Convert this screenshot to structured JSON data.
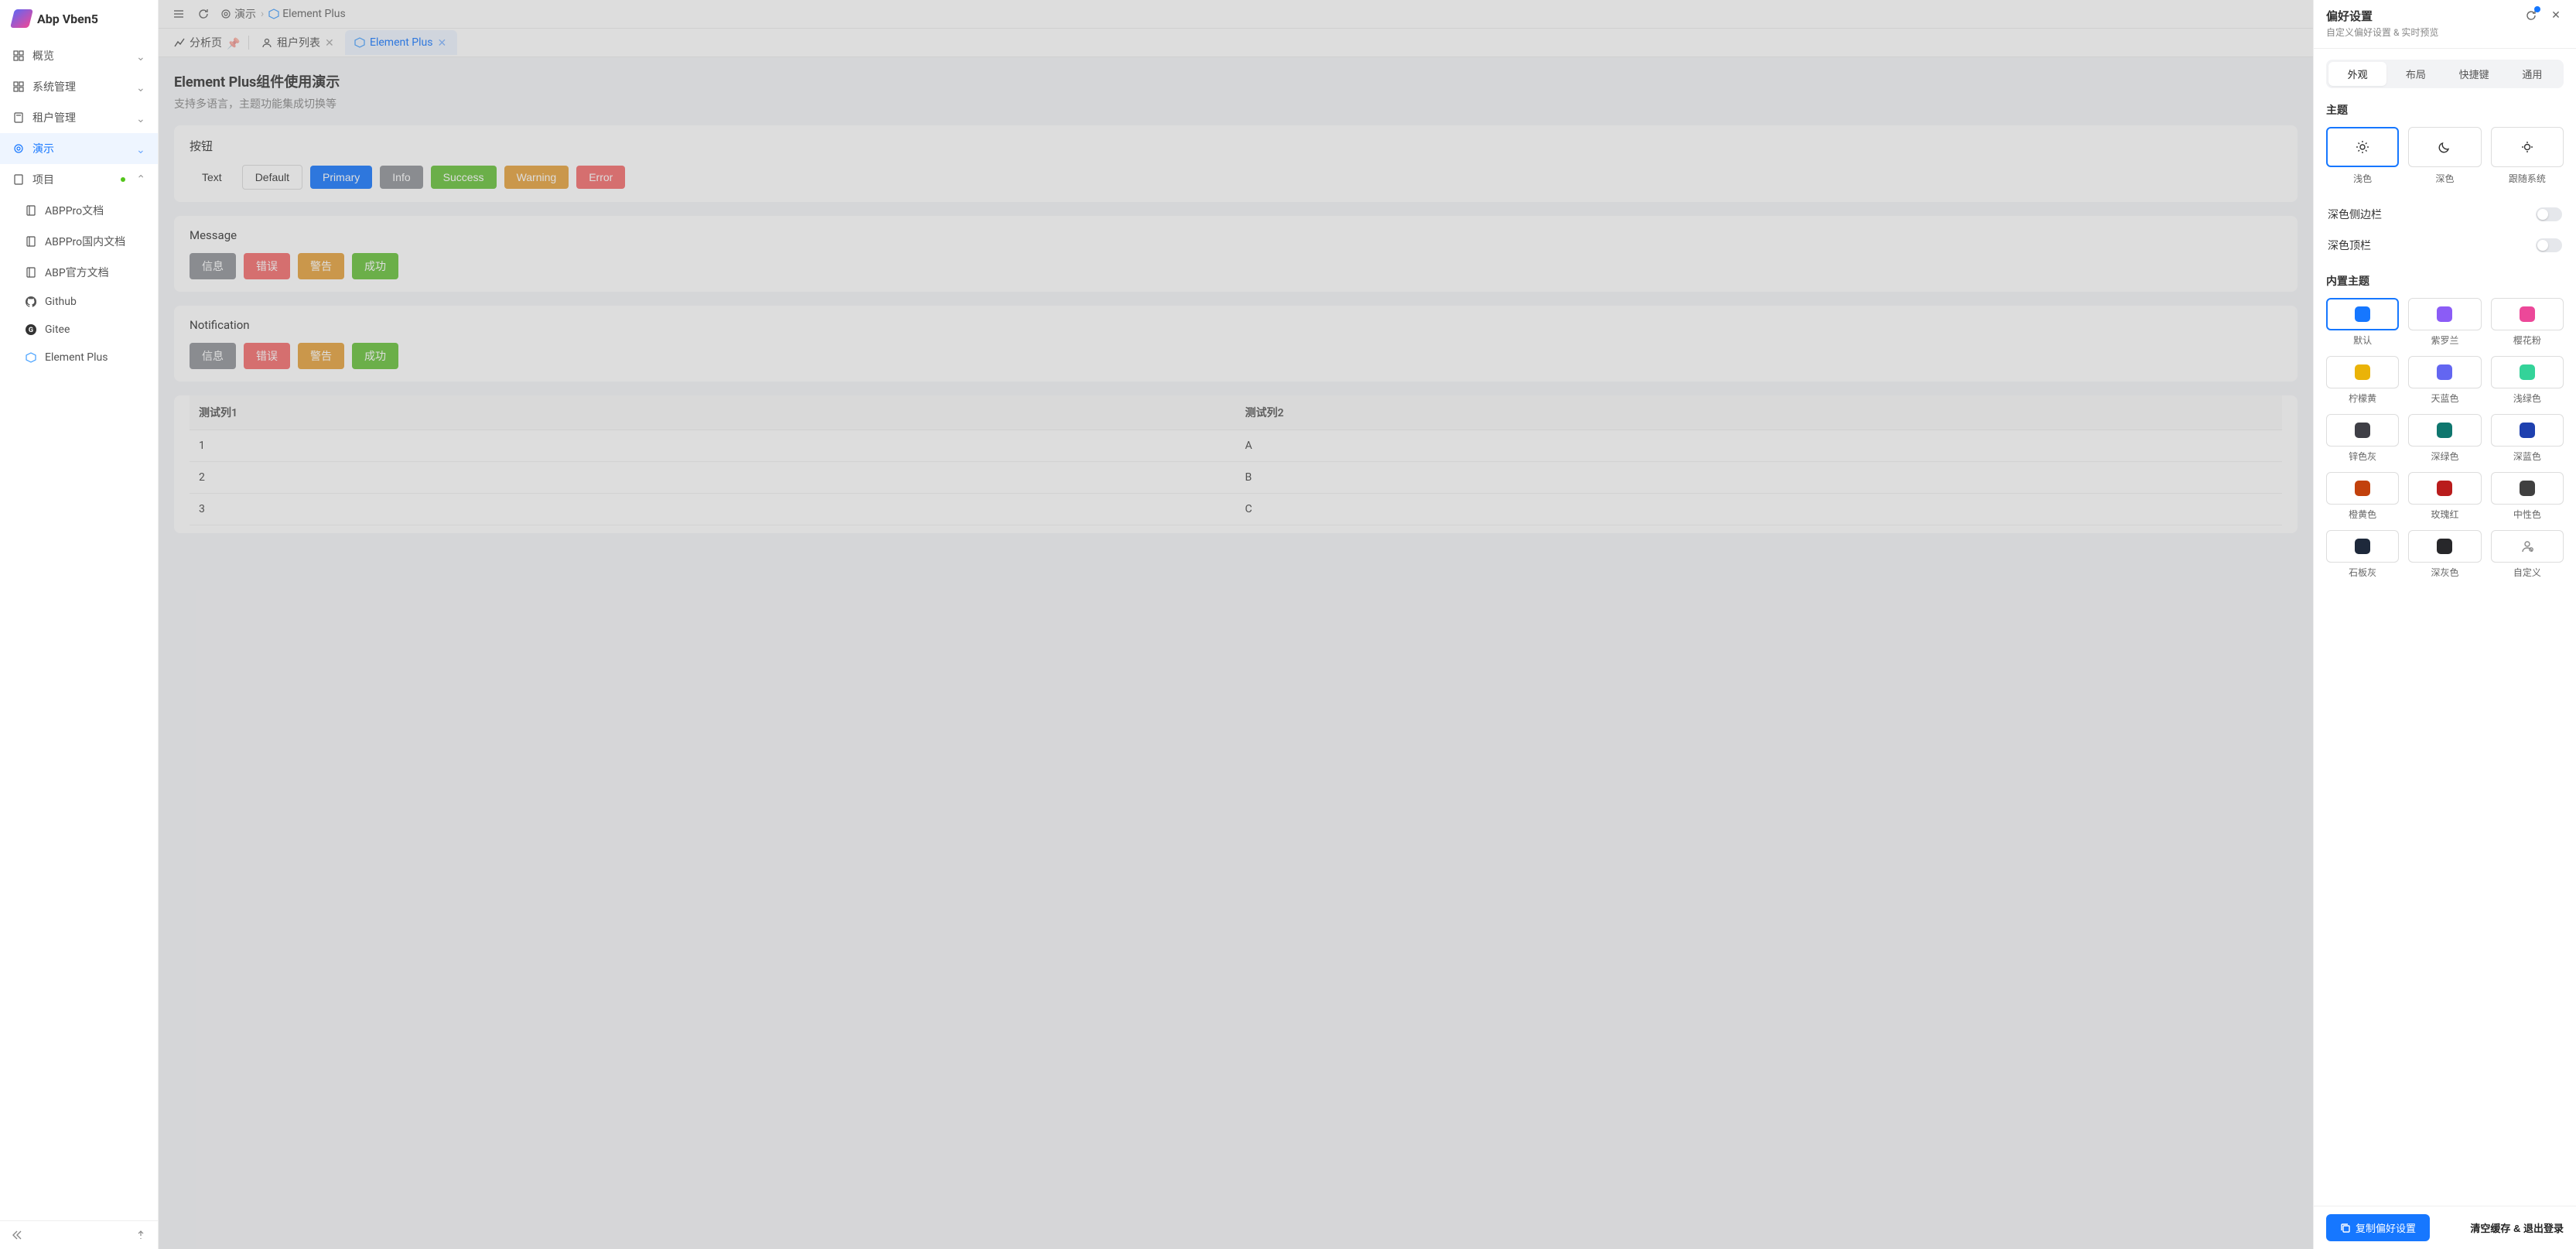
{
  "app": {
    "name": "Abp Vben5"
  },
  "sidebar": {
    "items": [
      {
        "label": "概览",
        "icon": "grid"
      },
      {
        "label": "系统管理",
        "icon": "grid"
      },
      {
        "label": "租户管理",
        "icon": "book"
      },
      {
        "label": "演示",
        "icon": "target",
        "active": true
      },
      {
        "label": "项目",
        "icon": "doc",
        "badge": true
      }
    ],
    "sub": [
      {
        "label": "ABPPro文档",
        "icon": "book"
      },
      {
        "label": "ABPPro国内文档",
        "icon": "book"
      },
      {
        "label": "ABP官方文档",
        "icon": "book"
      },
      {
        "label": "Github",
        "icon": "github"
      },
      {
        "label": "Gitee",
        "icon": "gitee"
      },
      {
        "label": "Element Plus",
        "icon": "ep"
      }
    ]
  },
  "breadcrumb": [
    {
      "label": "演示",
      "icon": "target"
    },
    {
      "label": "Element Plus",
      "icon": "ep"
    }
  ],
  "tabs": [
    {
      "label": "分析页",
      "icon": "chart",
      "pinned": true
    },
    {
      "label": "租户列表",
      "icon": "user",
      "closable": true
    },
    {
      "label": "Element Plus",
      "icon": "ep",
      "active": true,
      "closable": true
    }
  ],
  "page": {
    "title": "Element Plus组件使用演示",
    "subtitle": "支持多语言，主题功能集成切换等"
  },
  "cards": {
    "button": {
      "title": "按钮",
      "btns": [
        "Text",
        "Default",
        "Primary",
        "Info",
        "Success",
        "Warning",
        "Error"
      ]
    },
    "message": {
      "title": "Message",
      "btns": [
        "信息",
        "错误",
        "警告",
        "成功"
      ]
    },
    "notification": {
      "title": "Notification",
      "btns": [
        "信息",
        "错误",
        "警告",
        "成功"
      ]
    },
    "table": {
      "headers": [
        "测试列1",
        "测试列2"
      ],
      "rows": [
        [
          "1",
          "A"
        ],
        [
          "2",
          "B"
        ],
        [
          "3",
          "C"
        ]
      ]
    }
  },
  "drawer": {
    "title": "偏好设置",
    "subtitle": "自定义偏好设置 & 实时预览",
    "segs": [
      "外观",
      "布局",
      "快捷键",
      "通用"
    ],
    "theme": {
      "title": "主题",
      "modes": [
        "浅色",
        "深色",
        "跟随系统"
      ],
      "toggles": [
        "深色侧边栏",
        "深色顶栏"
      ]
    },
    "builtin": {
      "title": "内置主题",
      "colors": [
        {
          "label": "默认",
          "hex": "#1677ff",
          "active": true
        },
        {
          "label": "紫罗兰",
          "hex": "#8b5cf6"
        },
        {
          "label": "樱花粉",
          "hex": "#ec4899"
        },
        {
          "label": "柠檬黄",
          "hex": "#eab308"
        },
        {
          "label": "天蓝色",
          "hex": "#6366f1"
        },
        {
          "label": "浅绿色",
          "hex": "#34d399"
        },
        {
          "label": "锌色灰",
          "hex": "#3f3f46"
        },
        {
          "label": "深绿色",
          "hex": "#0f766e"
        },
        {
          "label": "深蓝色",
          "hex": "#1e40af"
        },
        {
          "label": "橙黄色",
          "hex": "#c2410c"
        },
        {
          "label": "玫瑰红",
          "hex": "#b91c1c"
        },
        {
          "label": "中性色",
          "hex": "#404040"
        },
        {
          "label": "石板灰",
          "hex": "#1e293b"
        },
        {
          "label": "深灰色",
          "hex": "#27272a"
        },
        {
          "label": "自定义",
          "hex": "",
          "custom": true
        }
      ]
    },
    "footer": {
      "copy": "复制偏好设置",
      "reset": "清空缓存 & 退出登录"
    }
  }
}
